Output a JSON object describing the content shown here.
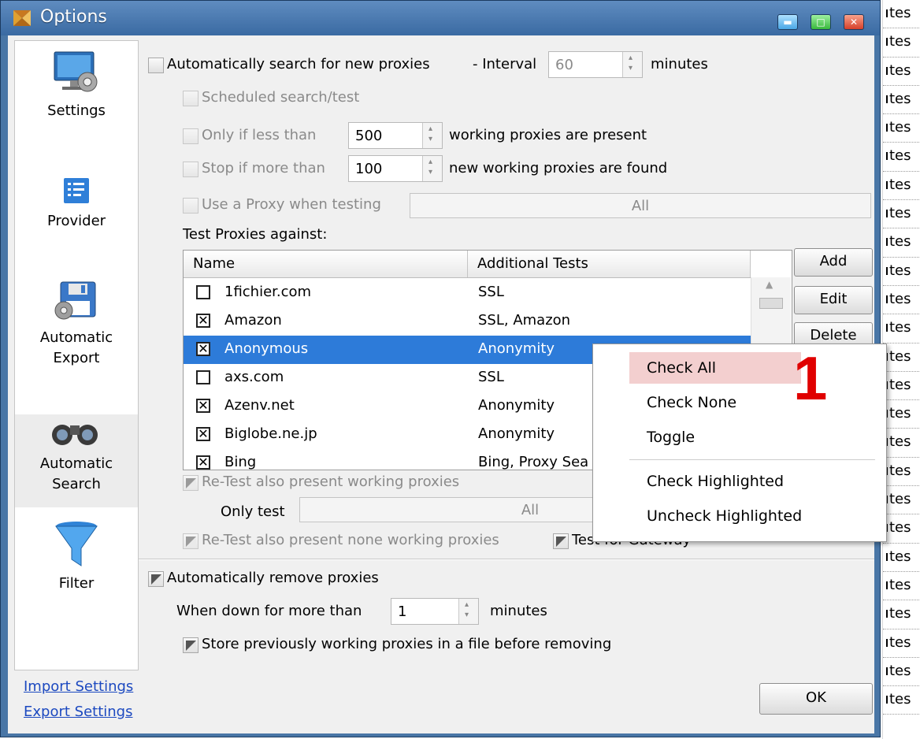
{
  "window": {
    "title": "Options"
  },
  "sidebar": {
    "items": [
      {
        "label": "Settings"
      },
      {
        "label": "Provider"
      },
      {
        "label": "Automatic Export"
      },
      {
        "label": "Automatic Search",
        "selected": true
      },
      {
        "label": "Filter"
      }
    ],
    "links": {
      "import": "Import Settings",
      "export": "Export Settings"
    }
  },
  "search": {
    "auto_search_label": "Automatically search for new proxies",
    "auto_search_checked": false,
    "interval_label": "- Interval",
    "interval_value": "60",
    "interval_unit": "minutes",
    "scheduled_label": "Scheduled search/test",
    "only_if_less_label": "Only if less than",
    "only_if_less_value": "500",
    "only_if_less_suffix": "working proxies are present",
    "stop_if_more_label": "Stop if more than",
    "stop_if_more_value": "100",
    "stop_if_more_suffix": "new working proxies are found",
    "use_proxy_label": "Use a Proxy when testing",
    "use_proxy_value": "All",
    "test_against_label": "Test Proxies against:"
  },
  "grid": {
    "columns": [
      "Name",
      "Additional Tests"
    ],
    "rows": [
      {
        "name": "1fichier.com",
        "tests": "SSL",
        "checked": false,
        "selected": false
      },
      {
        "name": "Amazon",
        "tests": "SSL, Amazon",
        "checked": true,
        "selected": false
      },
      {
        "name": "Anonymous",
        "tests": "Anonymity",
        "checked": true,
        "selected": true
      },
      {
        "name": "axs.com",
        "tests": "SSL",
        "checked": false,
        "selected": false
      },
      {
        "name": "Azenv.net",
        "tests": "Anonymity",
        "checked": true,
        "selected": false
      },
      {
        "name": "Biglobe.ne.jp",
        "tests": "Anonymity",
        "checked": true,
        "selected": false
      },
      {
        "name": "Bing",
        "tests": "Bing, Proxy Sea",
        "checked": true,
        "selected": false
      }
    ],
    "buttons": {
      "add": "Add",
      "edit": "Edit",
      "delete": "Delete"
    }
  },
  "retest": {
    "retest_working_label": "Re-Test also present working proxies",
    "only_test_label": "Only test",
    "only_test_value": "All",
    "retest_none_working_label": "Re-Test also present none working proxies",
    "gateway_label": "Test for Gateway"
  },
  "remove": {
    "auto_remove_label": "Automatically remove proxies",
    "down_label": "When down for more than",
    "down_value": "1",
    "down_unit": "minutes",
    "store_label": "Store previously working proxies in a file before removing"
  },
  "footer": {
    "ok_label": "OK"
  },
  "context_menu": {
    "items": [
      "Check All",
      "Check None",
      "Toggle",
      "Check Highlighted",
      "Uncheck Highlighted"
    ],
    "hot_index": 0,
    "badge": "1"
  },
  "background": {
    "row_text": "tes"
  },
  "colors": {
    "selection": "#2d7bd9",
    "titlebar": "#4976a6",
    "badge": "#e00000",
    "menu_hot": "#f3cfcf"
  }
}
